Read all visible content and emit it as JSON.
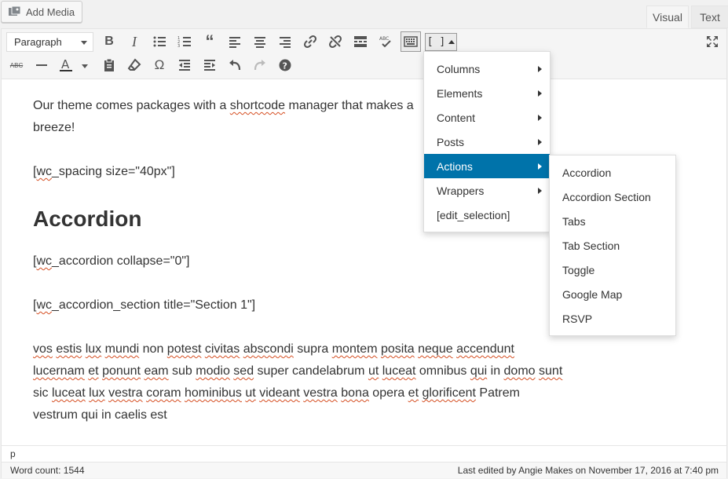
{
  "header": {
    "add_media_label": "Add Media",
    "tabs": [
      {
        "label": "Visual",
        "active": true
      },
      {
        "label": "Text",
        "active": false
      }
    ]
  },
  "toolbar": {
    "format_select": "Paragraph",
    "shortcode_button_label": "[ ]",
    "row1_icons": [
      "bold-icon",
      "italic-icon",
      "bulleted-list-icon",
      "numbered-list-icon",
      "blockquote-icon",
      "align-left-icon",
      "align-center-icon",
      "align-right-icon",
      "link-icon",
      "unlink-icon",
      "read-more-icon",
      "spellcheck-icon",
      "keyboard-icon"
    ],
    "row2_icons": [
      "strikethrough-icon",
      "horizontal-line-icon",
      "text-color-icon",
      "paste-text-icon",
      "clear-formatting-icon",
      "special-character-icon",
      "outdent-icon",
      "indent-icon",
      "undo-icon",
      "redo-icon",
      "help-icon"
    ],
    "fullscreen_icon": "fullscreen-icon"
  },
  "content": {
    "p1": {
      "a": "Our theme comes packages with a ",
      "b": "shortcode",
      "c": " manager that makes a",
      "d": "breeze!"
    },
    "p2": {
      "a": "[",
      "b": "wc",
      "c": "_spacing size=\"40px\"]"
    },
    "heading": "Accordion",
    "p3": {
      "a": "[",
      "b": "wc",
      "c": "_accordion collapse=\"0\"]"
    },
    "p4": {
      "a": "[",
      "b": "wc",
      "c": "_accordion_section title=\"Section 1\"]"
    },
    "p5": [
      {
        "t": "vos",
        "s": true
      },
      {
        "t": " ",
        "s": false
      },
      {
        "t": "estis",
        "s": true
      },
      {
        "t": " ",
        "s": false
      },
      {
        "t": "lux",
        "s": true
      },
      {
        "t": " ",
        "s": false
      },
      {
        "t": "mundi",
        "s": true
      },
      {
        "t": " non ",
        "s": false
      },
      {
        "t": "potest",
        "s": true
      },
      {
        "t": " ",
        "s": false
      },
      {
        "t": "civitas",
        "s": true
      },
      {
        "t": " ",
        "s": false
      },
      {
        "t": "abscondi",
        "s": true
      },
      {
        "t": " supra ",
        "s": false
      },
      {
        "t": "montem",
        "s": true
      },
      {
        "t": " ",
        "s": false
      },
      {
        "t": "posita",
        "s": true
      },
      {
        "t": " ",
        "s": false
      },
      {
        "t": "neque",
        "s": true
      },
      {
        "t": " ",
        "s": false
      },
      {
        "t": "accendunt",
        "s": true
      },
      {
        "t": " ",
        "s": false
      },
      {
        "t": "lucernam",
        "s": true
      },
      {
        "t": " ",
        "s": false
      },
      {
        "t": "et",
        "s": true
      },
      {
        "t": " ",
        "s": false
      },
      {
        "t": "ponunt",
        "s": true
      },
      {
        "t": " ",
        "s": false
      },
      {
        "t": "eam",
        "s": true
      },
      {
        "t": " sub ",
        "s": false
      },
      {
        "t": "modio",
        "s": true
      },
      {
        "t": " ",
        "s": false
      },
      {
        "t": "sed",
        "s": true
      },
      {
        "t": " super candelabrum ",
        "s": false
      },
      {
        "t": "ut",
        "s": true
      },
      {
        "t": " ",
        "s": false
      },
      {
        "t": "luceat",
        "s": true
      },
      {
        "t": " omnibus ",
        "s": false
      },
      {
        "t": "qui",
        "s": true
      },
      {
        "t": " in ",
        "s": false
      },
      {
        "t": "domo",
        "s": true
      },
      {
        "t": " ",
        "s": false
      },
      {
        "t": "sunt",
        "s": true
      },
      {
        "t": " sic ",
        "s": false
      },
      {
        "t": "luceat",
        "s": true
      },
      {
        "t": " ",
        "s": false
      },
      {
        "t": "lux",
        "s": true
      },
      {
        "t": " ",
        "s": false
      },
      {
        "t": "vestra",
        "s": true
      },
      {
        "t": " ",
        "s": false
      },
      {
        "t": "coram",
        "s": true
      },
      {
        "t": " ",
        "s": false
      },
      {
        "t": "hominibus",
        "s": true
      },
      {
        "t": " ",
        "s": false
      },
      {
        "t": "ut",
        "s": true
      },
      {
        "t": " ",
        "s": false
      },
      {
        "t": "videant",
        "s": true
      },
      {
        "t": " ",
        "s": false
      },
      {
        "t": "vestra",
        "s": true
      },
      {
        "t": " ",
        "s": false
      },
      {
        "t": "bona",
        "s": true
      },
      {
        "t": " opera ",
        "s": false
      },
      {
        "t": "et",
        "s": true
      },
      {
        "t": " ",
        "s": false
      },
      {
        "t": "glorificent",
        "s": true
      },
      {
        "t": " ",
        "s": false
      },
      {
        "t": "Patrem vestrum qui in caelis est",
        "s": false
      }
    ]
  },
  "shortcode_menu": {
    "items": [
      {
        "label": "Columns",
        "submenu": true,
        "active": false
      },
      {
        "label": "Elements",
        "submenu": true,
        "active": false
      },
      {
        "label": "Content",
        "submenu": true,
        "active": false
      },
      {
        "label": "Posts",
        "submenu": true,
        "active": false
      },
      {
        "label": "Actions",
        "submenu": true,
        "active": true
      },
      {
        "label": "Wrappers",
        "submenu": true,
        "active": false
      },
      {
        "label": "[edit_selection]",
        "submenu": false,
        "active": false
      }
    ],
    "actions_submenu": [
      "Accordion",
      "Accordion Section",
      "Tabs",
      "Tab Section",
      "Toggle",
      "Google Map",
      "RSVP"
    ]
  },
  "status": {
    "path": "p",
    "word_count": "Word count: 1544",
    "last_edited": "Last edited by Angie Makes on November 17, 2016 at 7:40 pm"
  },
  "colors": {
    "accent": "#0073aa",
    "spell_underline": "#d54e21"
  }
}
